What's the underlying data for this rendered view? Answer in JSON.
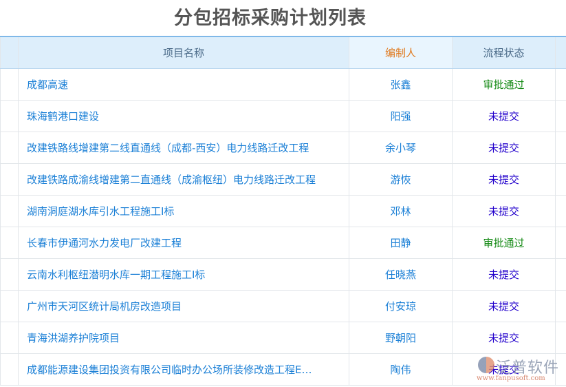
{
  "title": "分包招标采购计划列表",
  "columns": {
    "name": "项目名称",
    "editor": "编制人",
    "status": "流程状态"
  },
  "rows": [
    {
      "name": "成都高速",
      "editor": "张鑫",
      "status": "审批通过",
      "approved": true
    },
    {
      "name": "珠海鹤港口建设",
      "editor": "阳强",
      "status": "未提交",
      "approved": false
    },
    {
      "name": "改建铁路线增建第二线直通线（成都-西安）电力线路迁改工程",
      "editor": "余小琴",
      "status": "未提交",
      "approved": false
    },
    {
      "name": "改建铁路成渝线增建第二直通线（成渝枢纽）电力线路迁改工程",
      "editor": "游恢",
      "status": "未提交",
      "approved": false
    },
    {
      "name": "湖南洞庭湖水库引水工程施工I标",
      "editor": "邓林",
      "status": "未提交",
      "approved": false
    },
    {
      "name": "长春市伊通河水力发电厂改建工程",
      "editor": "田静",
      "status": "审批通过",
      "approved": true
    },
    {
      "name": "云南水利枢纽潜明水库一期工程施工I标",
      "editor": "任晓燕",
      "status": "未提交",
      "approved": false
    },
    {
      "name": "广州市天河区统计局机房改造项目",
      "editor": "付安琼",
      "status": "未提交",
      "approved": false
    },
    {
      "name": "青海洪湖养护院项目",
      "editor": "野朝阳",
      "status": "未提交",
      "approved": false
    },
    {
      "name": "成都能源建设集团投资有限公司临时办公场所装修改造工程E…",
      "editor": "陶伟",
      "status": "未提交",
      "approved": false
    }
  ],
  "watermark": {
    "cn": "泛普软件",
    "en": "www.fanpusoft.com"
  },
  "colors": {
    "link": "#1a7fd6",
    "approved": "#118811",
    "pending": "#2200cc",
    "editor_header": "#e07a1f"
  }
}
